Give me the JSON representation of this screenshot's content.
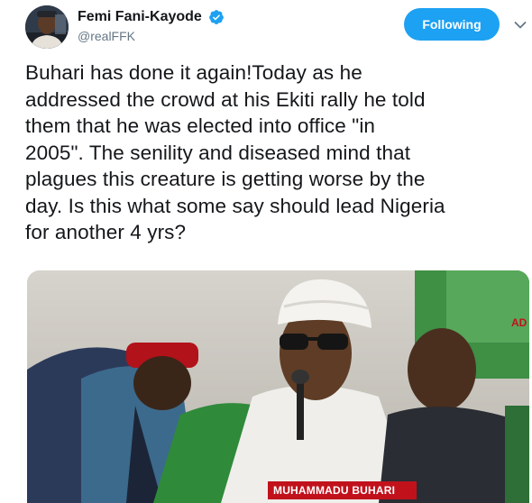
{
  "user": {
    "display_name": "Femi Fani-Kayode",
    "handle": "@realFFK",
    "verified": true
  },
  "actions": {
    "follow_label": "Following"
  },
  "tweet": {
    "lines": [
      "Buhari has done it again!Today as he",
      "addressed the crowd at his Ekiti rally he told",
      "them that he was elected into office \"in",
      "2005\". The senility and diseased mind that",
      "plagues this creature is getting worse by the",
      "day. Is this what some say should lead Nigeria",
      "for another 4 yrs?"
    ]
  },
  "media": {
    "caption": "MUHAMMADU BUHARI",
    "corner_text": "AD"
  },
  "colors": {
    "accent": "#1da1f2",
    "text": "#14171a",
    "secondary": "#657786",
    "caption_bg": "#c1121c"
  },
  "icons": {
    "verified": "verified-badge-icon",
    "caret": "chevron-down-icon"
  }
}
